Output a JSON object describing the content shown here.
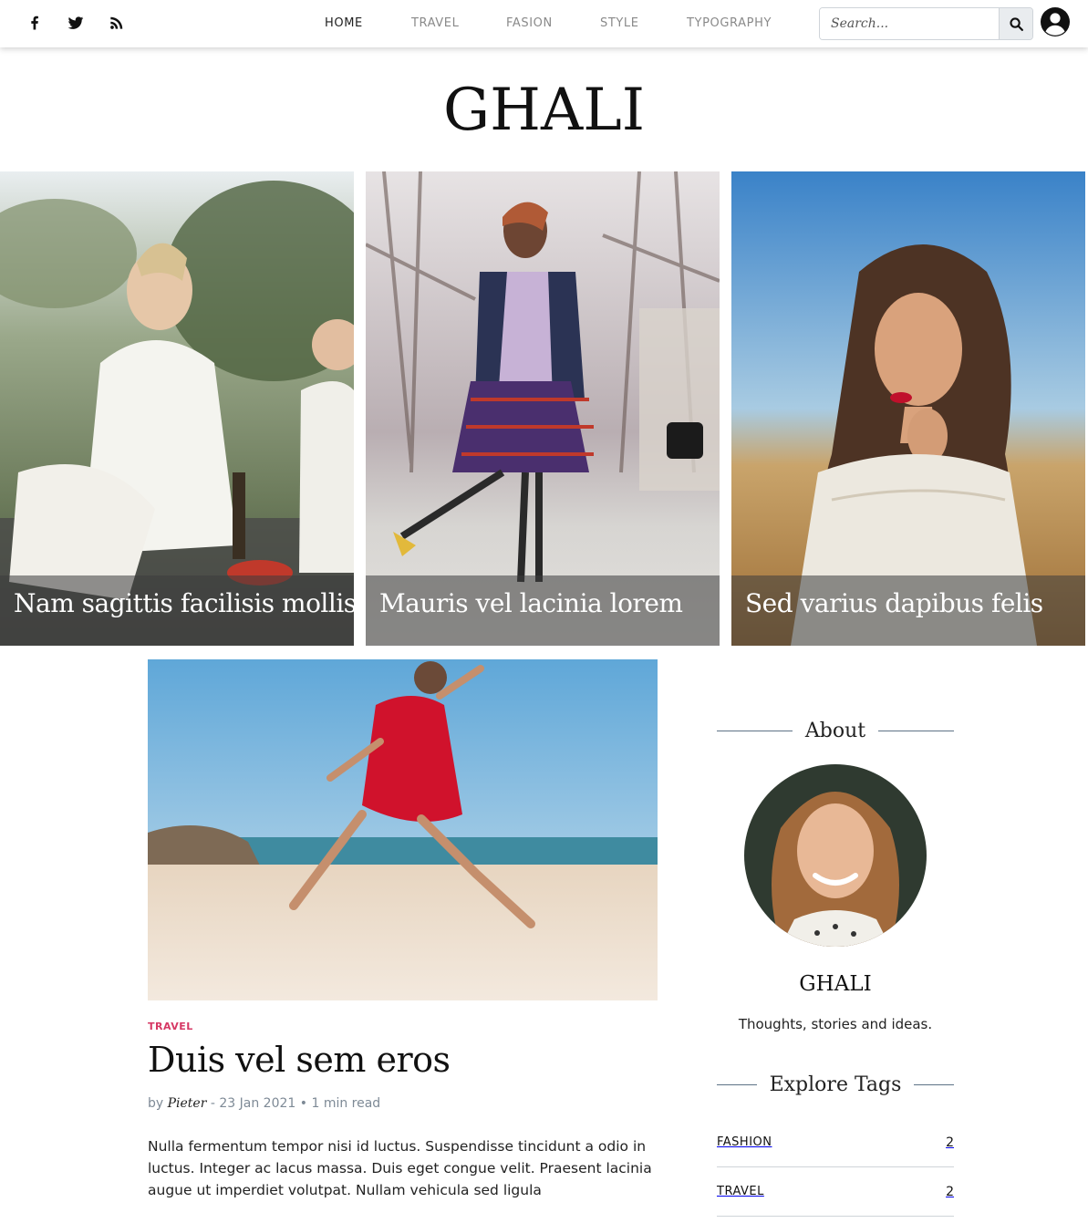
{
  "social": [
    {
      "name": "facebook-icon"
    },
    {
      "name": "twitter-icon"
    },
    {
      "name": "rss-icon"
    }
  ],
  "nav": {
    "items": [
      "HOME",
      "TRAVEL",
      "FASION",
      "STYLE",
      "TYPOGRAPHY"
    ],
    "active": "HOME"
  },
  "search": {
    "placeholder": "Search...",
    "icon": "search-icon"
  },
  "account": {
    "icon": "user-account-icon"
  },
  "brand": {
    "title": "GHALI"
  },
  "featured": [
    {
      "title": "Nam sagittis facilisis mollis"
    },
    {
      "title": "Mauris vel lacinia lorem"
    },
    {
      "title": "Sed varius dapibus felis"
    }
  ],
  "post": {
    "category": "TRAVEL",
    "title": "Duis vel sem eros",
    "meta": {
      "by": "by",
      "author": "Pieter",
      "rest": " - 23 Jan 2021 • 1 min read"
    },
    "excerpt": "Nulla fermentum tempor nisi id luctus. Suspendisse tincidunt a odio in luctus. Integer ac lacus massa. Duis eget congue velit. Praesent lacinia augue ut imperdiet volutpat. Nullam vehicula sed ligula"
  },
  "sidebar": {
    "about_heading": "About",
    "name": "GHALI",
    "tagline": "Thoughts, stories and ideas.",
    "tags_heading": "Explore Tags",
    "tags": [
      {
        "name": "FASHION",
        "count": "2"
      },
      {
        "name": "TRAVEL",
        "count": "2"
      }
    ]
  },
  "colors": {
    "accent": "#d63864",
    "meta": "#7e8a96",
    "divider": "#5d7286"
  }
}
